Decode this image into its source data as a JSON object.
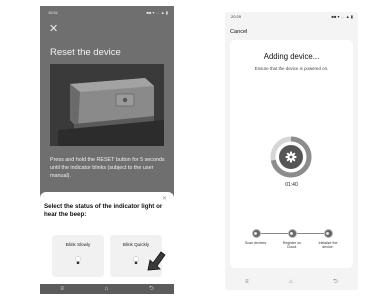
{
  "left_screen": {
    "status": {
      "time": "16:51",
      "icons": "■■ ▾ … ▲ ▮"
    },
    "close_glyph": "✕",
    "title": "Reset the device",
    "instruction": "Press and hold the RESET button for 5 seconds until the indicator blinks (subject to the user manual).",
    "sheet": {
      "close_glyph": "✕",
      "title": "Select the status of the indicator light or hear the beep:",
      "options": [
        {
          "label": "Blink Slowly",
          "icon": "bulb-icon"
        },
        {
          "label": "Blink Quickly",
          "icon": "bulb-icon"
        }
      ]
    },
    "nav": {
      "menu": "≡",
      "home": "⌂",
      "back": "⮌"
    }
  },
  "right_screen": {
    "status": {
      "time": "20:29",
      "icons": "■■ ▾ … ▲ ▮"
    },
    "cancel_label": "Cancel",
    "title": "Adding device...",
    "subtitle": "Ensure that the device is powered on.",
    "center_icon": "gear-icon",
    "progress_fraction": 0.72,
    "timer": "01:40",
    "steps": [
      {
        "label": "Scan devices."
      },
      {
        "label": "Register on Cloud."
      },
      {
        "label": "Initialize the device."
      }
    ],
    "nav": {
      "menu": "≡",
      "home": "⌂",
      "back": "⮌"
    }
  },
  "colors": {
    "left_overlay": "#6f6f6f",
    "sheet_bg": "#ffffff",
    "option_bg": "#f1f1f1",
    "ring_dark": "#555555",
    "ring_light": "#cfcfcf"
  }
}
